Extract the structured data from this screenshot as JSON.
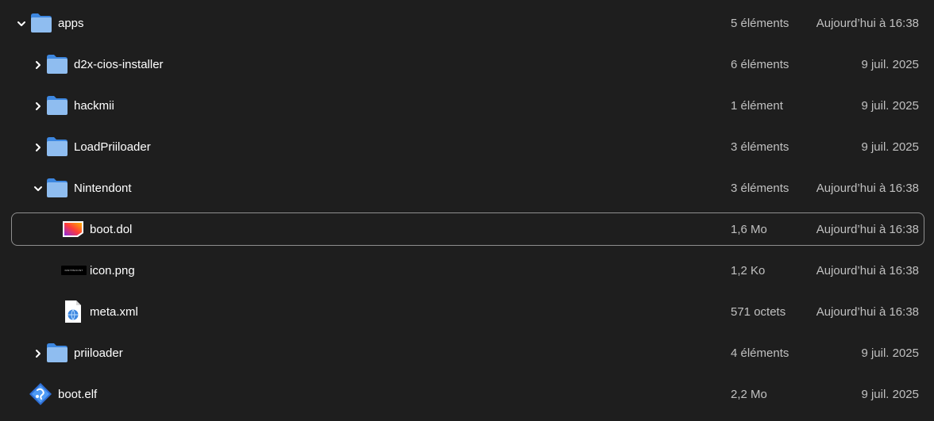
{
  "rows": [
    {
      "name": "apps",
      "size": "5 éléments",
      "date": "Aujourd’hui à 16:38"
    },
    {
      "name": "d2x-cios-installer",
      "size": "6 éléments",
      "date": "9 juil. 2025"
    },
    {
      "name": "hackmii",
      "size": "1 élément",
      "date": "9 juil. 2025"
    },
    {
      "name": "LoadPriiloader",
      "size": "3 éléments",
      "date": "9 juil. 2025"
    },
    {
      "name": "Nintendont",
      "size": "3 éléments",
      "date": "Aujourd’hui à 16:38"
    },
    {
      "name": "boot.dol",
      "size": "1,6 Mo",
      "date": "Aujourd’hui à 16:38"
    },
    {
      "name": "icon.png",
      "size": "1,2 Ko",
      "date": "Aujourd’hui à 16:38",
      "thumb_text": "NINTENDONT"
    },
    {
      "name": "meta.xml",
      "size": "571 octets",
      "date": "Aujourd’hui à 16:38"
    },
    {
      "name": "priiloader",
      "size": "4 éléments",
      "date": "9 juil. 2025"
    },
    {
      "name": "boot.elf",
      "size": "2,2 Mo",
      "date": "9 juil. 2025"
    }
  ],
  "colors": {
    "background": "#1e1e1e",
    "folder": "#8fbdf0",
    "folder_tab": "#3d87e0",
    "selection_border": "#8f8f8f",
    "secondary_text": "#c0c0c0"
  },
  "icons": {
    "folder": "folder-icon",
    "expanded": "chevron-down-icon",
    "collapsed": "chevron-right-icon",
    "dol": "executable-file-icon",
    "png": "image-thumbnail-icon",
    "xml": "xml-document-icon",
    "elf": "elf-binary-icon"
  }
}
